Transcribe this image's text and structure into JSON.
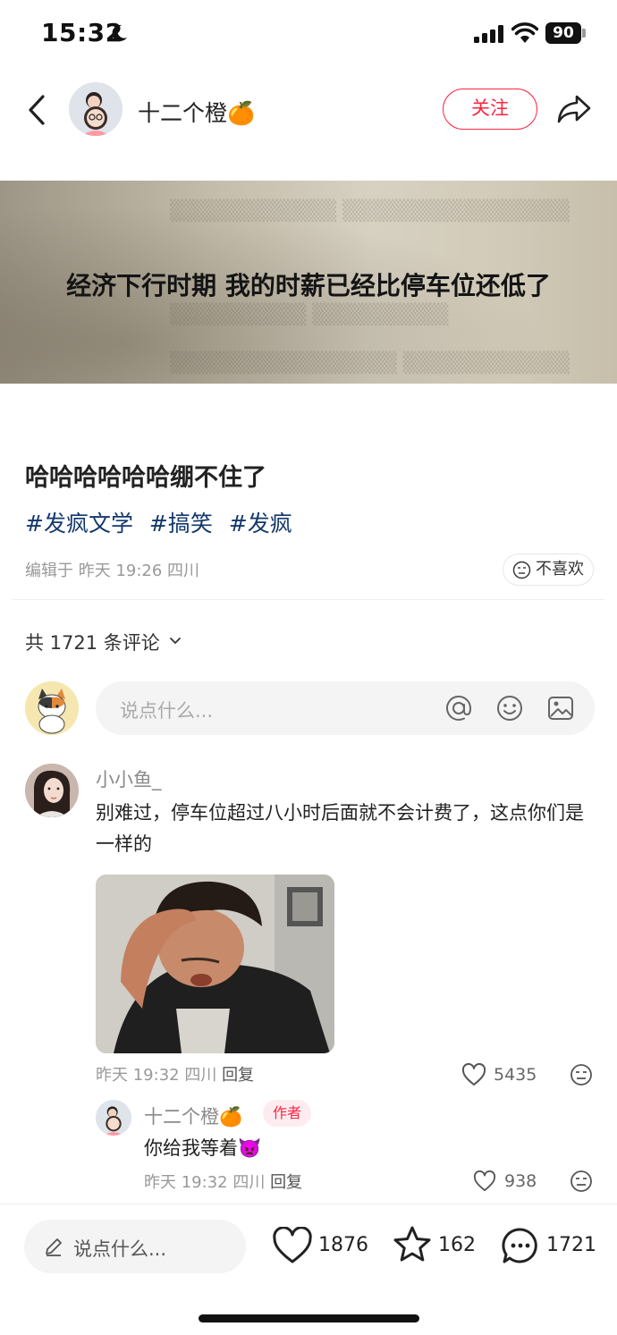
{
  "status_bar": {
    "time": "15:32",
    "battery": "90"
  },
  "header": {
    "author_name": "十二个橙🍊",
    "follow_label": "关注"
  },
  "cover": {
    "text": "经济下行时期 我的时薪已经比停车位还低了"
  },
  "post": {
    "title": "哈哈哈哈哈哈绷不住了",
    "tags": [
      "#发疯文学",
      "#搞笑",
      "#发疯"
    ],
    "meta": "编辑于 昨天 19:26 四川",
    "dislike_label": "不喜欢"
  },
  "comments_section": {
    "count_label": "共 1721 条评论",
    "input_placeholder": "说点什么..."
  },
  "comments": [
    {
      "name": "小小鱼_",
      "text": "别难过，停车位超过八小时后面就不会计费了，这点你们是一样的",
      "meta": "昨天 19:32 四川",
      "reply_label": "回复",
      "likes": "5435",
      "replies": [
        {
          "name": "十二个橙🍊",
          "badge": "作者",
          "text": "你给我等着👿",
          "meta": "昨天 19:32 四川",
          "reply_label": "回复",
          "likes": "938"
        }
      ]
    }
  ],
  "bottom_bar": {
    "input_placeholder": "说点什么...",
    "likes": "1876",
    "favorites": "162",
    "comments": "1721"
  },
  "colors": {
    "accent": "#ff2442",
    "tag": "#13386c"
  }
}
